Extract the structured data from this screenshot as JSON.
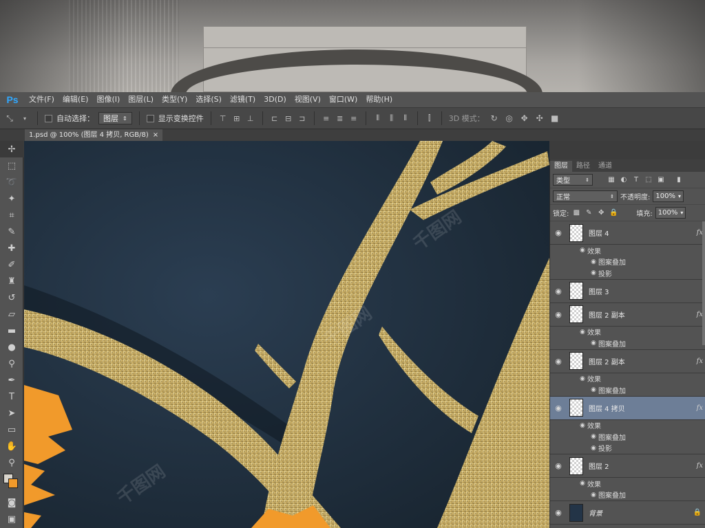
{
  "app": {
    "logo": "Ps"
  },
  "menu": [
    "文件(F)",
    "编辑(E)",
    "图像(I)",
    "图层(L)",
    "类型(Y)",
    "选择(S)",
    "滤镜(T)",
    "3D(D)",
    "视图(V)",
    "窗口(W)",
    "帮助(H)"
  ],
  "options": {
    "auto_select_label": "自动选择：",
    "auto_select_value": "图层",
    "show_transform_label": "显示变换控件",
    "mode_3d_label": "3D 模式："
  },
  "document": {
    "tab_title": "1.psd @ 100% (图层 4 拷贝, RGB/8)",
    "close": "×"
  },
  "layers_panel": {
    "tabs": [
      "图层",
      "路径",
      "通道"
    ],
    "filter_kind": "类型",
    "blend_mode": "正常",
    "opacity_label": "不透明度:",
    "opacity_value": "100%",
    "lock_label": "锁定:",
    "fill_label": "填充:",
    "fill_value": "100%",
    "layers": [
      {
        "name": "图层 4",
        "fx": "fx",
        "effects": [
          "效果",
          "图案叠加",
          "投影"
        ],
        "selected": false
      },
      {
        "name": "图层 3",
        "fx": "",
        "effects": [],
        "selected": false
      },
      {
        "name": "图层 2 副本",
        "fx": "fx",
        "effects": [
          "效果",
          "图案叠加"
        ],
        "selected": false
      },
      {
        "name": "图层 2 副本",
        "fx": "fx",
        "effects": [
          "效果",
          "图案叠加"
        ],
        "selected": false
      },
      {
        "name": "图层 4 拷贝",
        "fx": "fx",
        "effects": [
          "效果",
          "图案叠加",
          "投影"
        ],
        "selected": true
      },
      {
        "name": "图层 2",
        "fx": "fx",
        "effects": [
          "效果",
          "图案叠加"
        ],
        "selected": false
      },
      {
        "name": "背景",
        "fx": "",
        "effects": [],
        "selected": false,
        "locked": true
      }
    ]
  },
  "colors": {
    "foreground": "#d8d4cc",
    "background": "#f19a2b",
    "canvas": "#233447",
    "gold": "#d9c27a",
    "accent_selected": "#6d7e97"
  },
  "watermark": "千图网"
}
